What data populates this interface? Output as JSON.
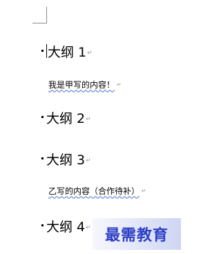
{
  "document": {
    "headings": [
      {
        "label": "大纲 1",
        "pilcrow": "↵"
      },
      {
        "label": "大纲 2",
        "pilcrow": "↵"
      },
      {
        "label": "大纲 3",
        "pilcrow": "↵"
      },
      {
        "label": "大纲 4",
        "pilcrow": "↵"
      }
    ],
    "paragraphs": [
      {
        "text": "我是甲写的内容！",
        "pilcrow": "↵"
      },
      {
        "text": "乙写的内容（合作待补）",
        "pilcrow": "↵"
      }
    ]
  },
  "watermark": {
    "text": "最需教育"
  }
}
